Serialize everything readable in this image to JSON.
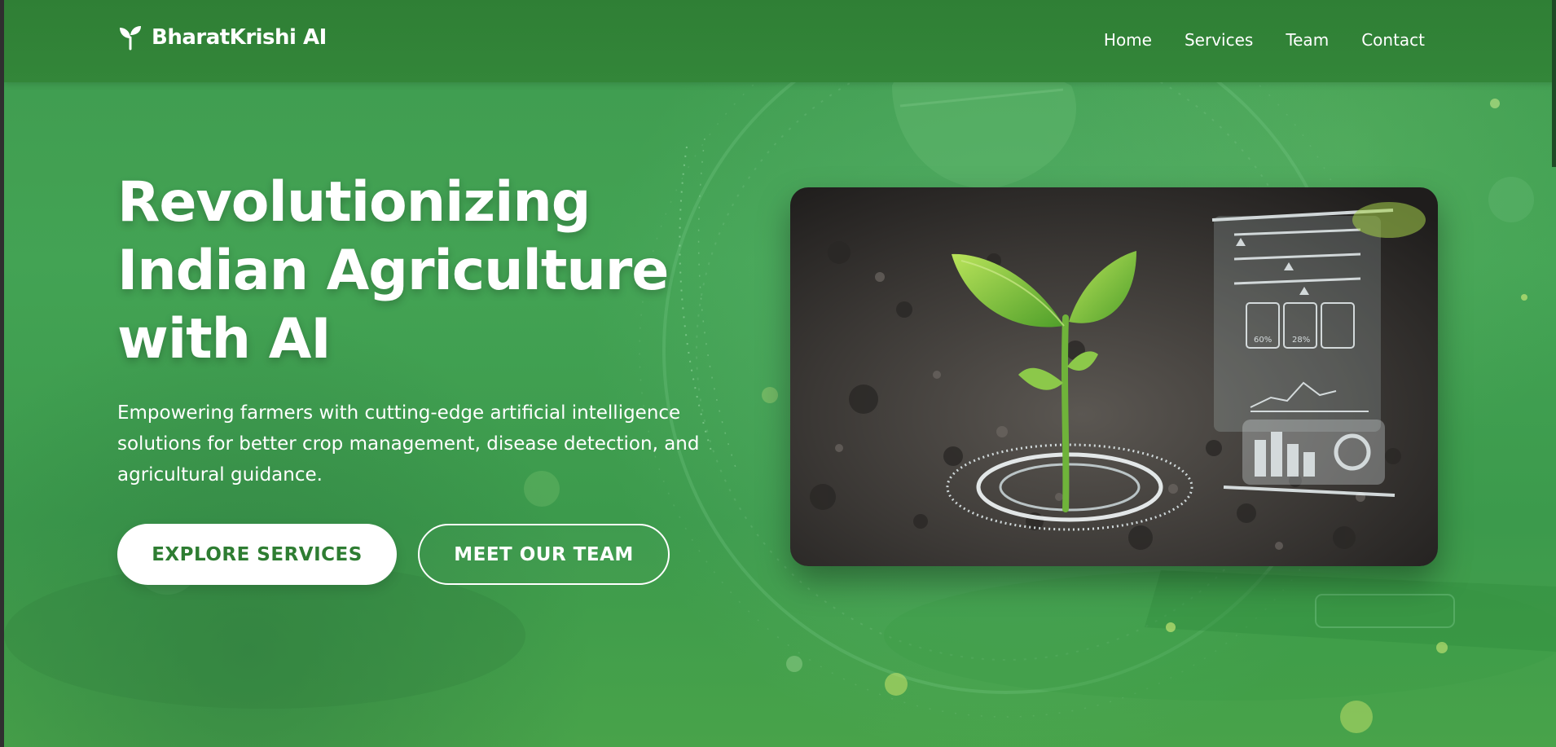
{
  "brand": {
    "name": "BharatKrishi AI",
    "icon": "sprout-icon"
  },
  "nav": {
    "items": [
      {
        "label": "Home"
      },
      {
        "label": "Services"
      },
      {
        "label": "Team"
      },
      {
        "label": "Contact"
      }
    ]
  },
  "hero": {
    "headline_lines": [
      "Revolutionizing",
      "Indian Agriculture",
      "with AI"
    ],
    "subtitle_lines": [
      "Empowering farmers with cutting-edge artificial intelligence",
      "solutions for better crop management, disease detection, and",
      "agricultural guidance."
    ],
    "primary_button": "EXPLORE SERVICES",
    "secondary_button": "MEET OUR TEAM",
    "image": {
      "subject": "seedling in soil with holographic data interface",
      "readouts": [
        "60%",
        "28%"
      ]
    }
  },
  "colors": {
    "navbar": "#2f7f35",
    "hero_green": "#43a354",
    "primary_button_text": "#2e7d32",
    "white": "#ffffff"
  }
}
